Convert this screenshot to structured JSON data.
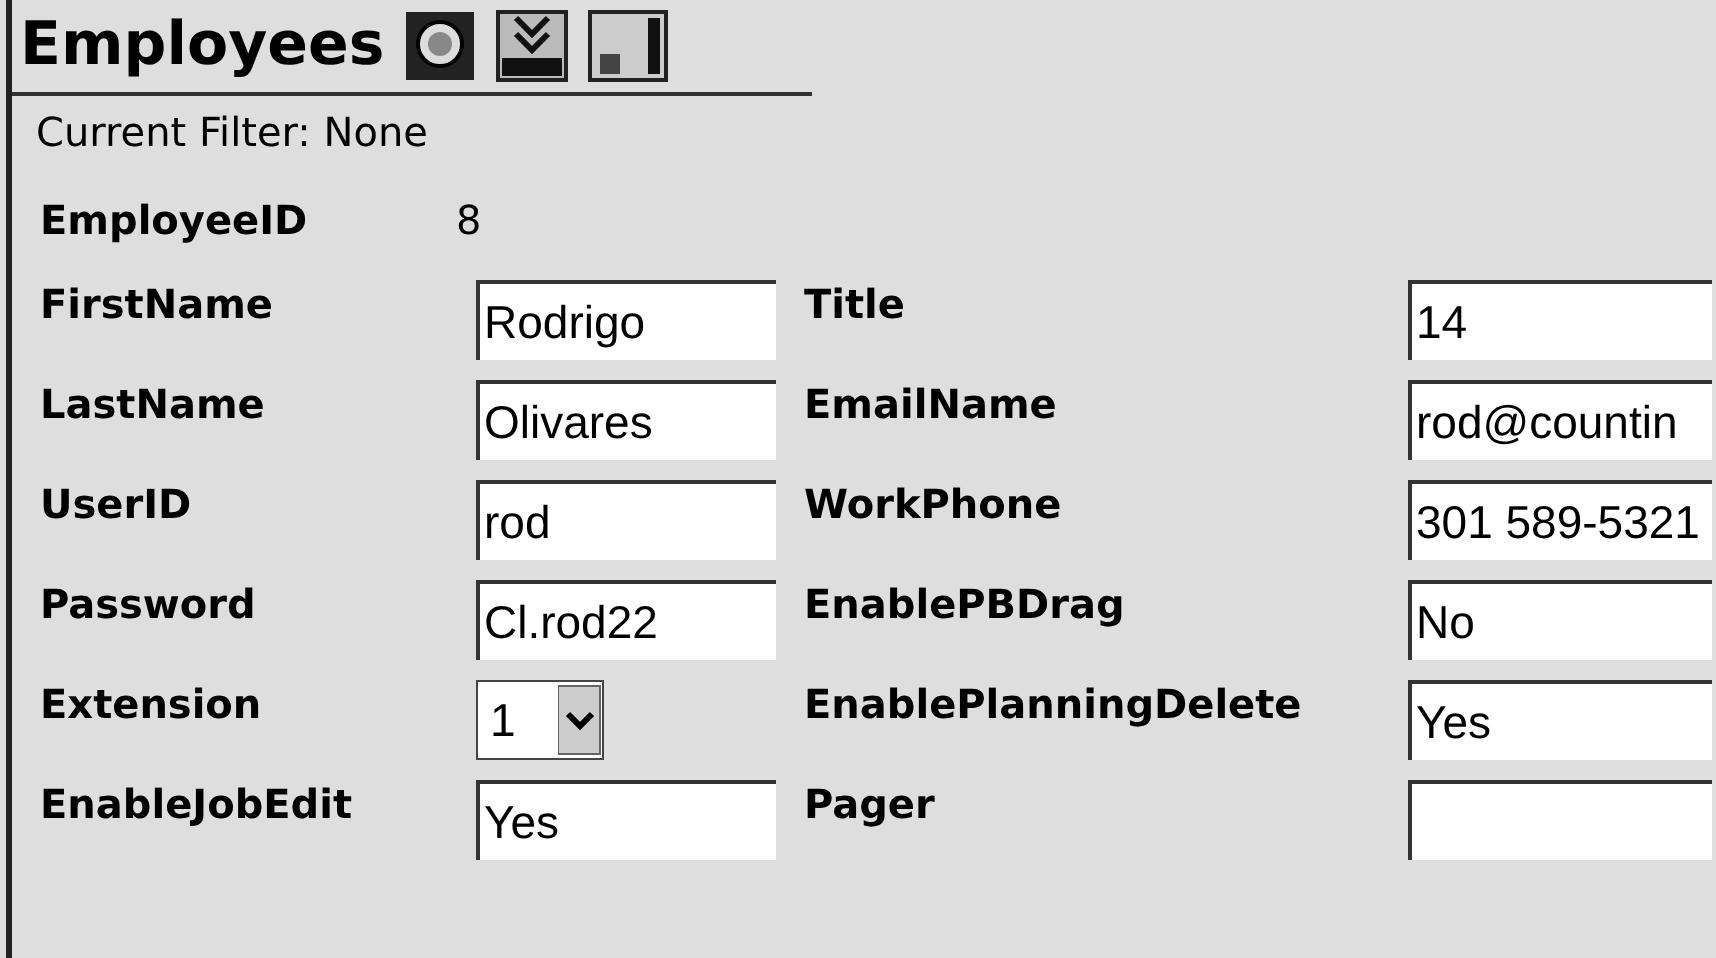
{
  "header": {
    "title": "Employees"
  },
  "filter": "Current Filter: None",
  "employee_id": {
    "label": "EmployeeID",
    "value": "8"
  },
  "left_fields": [
    {
      "label": "FirstName",
      "kind": "text",
      "value": "Rodrigo"
    },
    {
      "label": "LastName",
      "kind": "text",
      "value": "Olivares"
    },
    {
      "label": "UserID",
      "kind": "text",
      "value": "rod"
    },
    {
      "label": "Password",
      "kind": "text",
      "value": "Cl.rod22"
    },
    {
      "label": "Extension",
      "kind": "select",
      "value": "1"
    },
    {
      "label": "EnableJobEdit",
      "kind": "text",
      "value": "Yes"
    }
  ],
  "right_fields": [
    {
      "label": "Title",
      "kind": "text",
      "value": "14"
    },
    {
      "label": "EmailName",
      "kind": "text",
      "value": "rod@countin"
    },
    {
      "label": "WorkPhone",
      "kind": "text",
      "value": "301 589-5321"
    },
    {
      "label": "EnablePBDrag",
      "kind": "text",
      "value": "No"
    },
    {
      "label": "EnablePlanningDelete",
      "kind": "text",
      "value": "Yes"
    },
    {
      "label": "Pager",
      "kind": "text"
    }
  ]
}
